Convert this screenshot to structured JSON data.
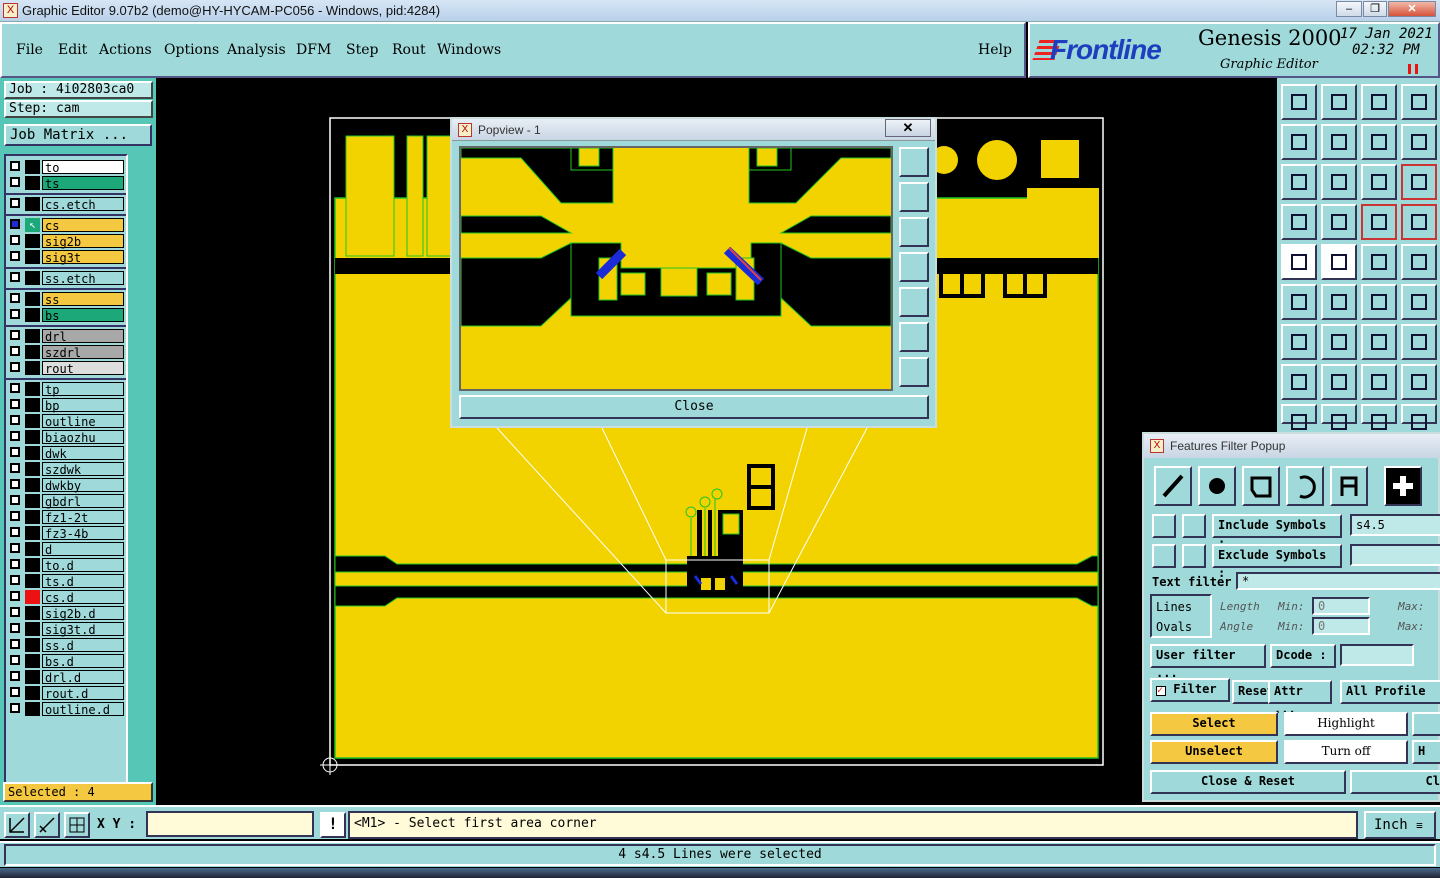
{
  "window": {
    "title": "Graphic Editor 9.07b2 (demo@HY-HYCAM-PC056 - Windows, pid:4284)",
    "app_icon": "X",
    "controls": [
      "minimize",
      "restore",
      "close"
    ]
  },
  "menu": {
    "items": [
      "File",
      "Edit",
      "Actions",
      "Options",
      "Analysis",
      "DFM",
      "Step",
      "Rout",
      "Windows"
    ],
    "help": "Help"
  },
  "brand": {
    "logo": "Frontline",
    "product": "Genesis 2000",
    "subtitle": "Graphic Editor",
    "date": "17 Jan 2021",
    "time": "02:32 PM"
  },
  "left": {
    "job": "Job : 4i02803ca0",
    "step": "Step: cam",
    "matrix_button": "Job Matrix ...",
    "selected": "Selected : 4",
    "layers": [
      {
        "name": "to",
        "color": "#ffffff"
      },
      {
        "name": "ts",
        "color": "#1ca878"
      },
      {
        "name": "cs.etch",
        "color": "#9fd9d9"
      },
      {
        "name": "cs",
        "color": "#f5c842",
        "active": true
      },
      {
        "name": "sig2b",
        "color": "#f5c842"
      },
      {
        "name": "sig3t",
        "color": "#f5c842"
      },
      {
        "name": "ss.etch",
        "color": "#9fd9d9"
      },
      {
        "name": "ss",
        "color": "#f5c842"
      },
      {
        "name": "bs",
        "color": "#1ca878"
      },
      {
        "name": "drl",
        "color": "#a8a8a8"
      },
      {
        "name": "szdrl",
        "color": "#a8a8a8"
      },
      {
        "name": "rout",
        "color": "#dddddd"
      },
      {
        "name": "tp",
        "color": "#9fd9d9"
      },
      {
        "name": "bp",
        "color": "#9fd9d9"
      },
      {
        "name": "outline",
        "color": "#9fd9d9"
      },
      {
        "name": "biaozhu",
        "color": "#9fd9d9"
      },
      {
        "name": "dwk",
        "color": "#9fd9d9"
      },
      {
        "name": "szdwk",
        "color": "#9fd9d9"
      },
      {
        "name": "dwkby",
        "color": "#9fd9d9"
      },
      {
        "name": "gbdrl",
        "color": "#9fd9d9"
      },
      {
        "name": "fz1-2t",
        "color": "#9fd9d9"
      },
      {
        "name": "fz3-4b",
        "color": "#9fd9d9"
      },
      {
        "name": "d",
        "color": "#9fd9d9"
      },
      {
        "name": "to.d",
        "color": "#9fd9d9"
      },
      {
        "name": "ts.d",
        "color": "#9fd9d9"
      },
      {
        "name": "cs.d",
        "color": "#9fd9d9",
        "mark": "#e11"
      },
      {
        "name": "sig2b.d",
        "color": "#9fd9d9"
      },
      {
        "name": "sig3t.d",
        "color": "#9fd9d9"
      },
      {
        "name": "ss.d",
        "color": "#9fd9d9"
      },
      {
        "name": "bs.d",
        "color": "#9fd9d9"
      },
      {
        "name": "drl.d",
        "color": "#9fd9d9"
      },
      {
        "name": "rout.d",
        "color": "#9fd9d9"
      },
      {
        "name": "outline.d",
        "color": "#9fd9d9"
      }
    ]
  },
  "popview": {
    "title": "Popview - 1",
    "close_x": "✕",
    "close_button": "Close"
  },
  "filter": {
    "title": "Features Filter Popup",
    "include_label": "Include Symbols :",
    "include_value": "s4.5",
    "exclude_label": "Exclude Symbols :",
    "exclude_value": "",
    "text_filter_label": "Text filter",
    "text_filter_value": "*",
    "lines": "Lines",
    "ovals": "Ovals",
    "length": "Length",
    "angle": "Angle",
    "min": "Min:",
    "max": "Max:",
    "min_value": "0",
    "user_filter": "User filter ...",
    "dcode": "Dcode :",
    "filter": "Filter",
    "reset": "Reset",
    "attr": "Attr ...",
    "all_profile": "All Profile",
    "select": "Select",
    "highlight": "Highlight",
    "unselect": "Unselect",
    "turn_off": "Turn off",
    "close_reset": "Close & Reset",
    "cl_fragment": "Cl",
    "h_fragment": "H"
  },
  "cmd": {
    "xy_label": "X Y :",
    "prompt": "<M1> - Select first area corner",
    "units": "Inch"
  },
  "status": {
    "message": "4 s4.5 Lines were selected"
  },
  "colors": {
    "copper": "#f2d300",
    "outline_green": "#22c422",
    "panel": "#9fd9d9",
    "select_blue": "#1b2bd8"
  }
}
